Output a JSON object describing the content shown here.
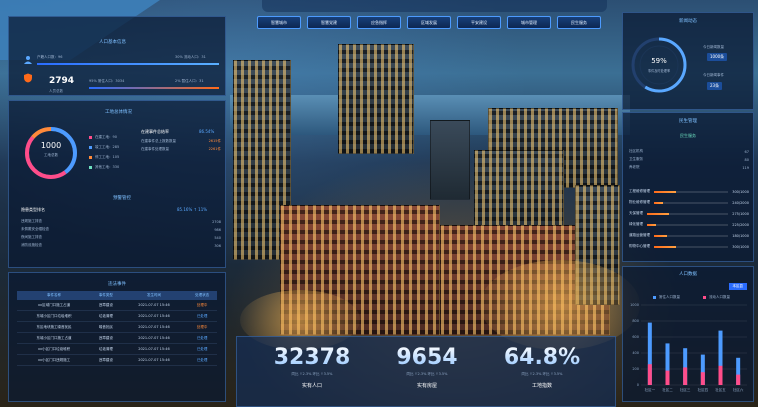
{
  "nav": {
    "items": [
      "智慧城市",
      "智慧党建",
      "应急指挥",
      "区域发展",
      "平安建设",
      "城市管理",
      "民生服务"
    ]
  },
  "left_top": {
    "title": "人口基本信息",
    "row1": {
      "label": "户籍人口数：96",
      "ratio": "30% 流动人口：31"
    },
    "row2": {
      "big": "2794",
      "big_sub": "人员总数",
      "label_left": "95% 常住人口：3034",
      "label_right": "2% 暂住人口：31"
    }
  },
  "left_mid": {
    "title": "工地总体情况",
    "ring_value": "1000",
    "ring_label": "工地总数",
    "legend": [
      "在建工地：90",
      "竣工工地：285",
      "停工工地：105",
      "其他工地：330"
    ],
    "right_title": "在建事件总结率",
    "right_rate": "86.54%",
    "right_rows": [
      {
        "label": "在建事件总上报数数量",
        "value": "2615件"
      },
      {
        "label": "在建事件处理数量",
        "value": "2261件"
      }
    ],
    "mid_title": "预警管控",
    "list_title": "隐患类型排名",
    "list_rate": "85.16% ↑ 11%",
    "list": [
      {
        "label": "违规施工排查",
        "value": "2708"
      },
      {
        "label": "未佩戴安全帽检查",
        "value": "986"
      },
      {
        "label": "夜间施工排查",
        "value": "540"
      },
      {
        "label": "消防设施检查",
        "value": "306"
      }
    ]
  },
  "left_bot": {
    "title": "违法事件",
    "headers": [
      "事件名称",
      "事件类型",
      "发生时间",
      "处理状态"
    ],
    "rows": [
      [
        "xx区域门口施工占道",
        "违章建设",
        "2021-07-07 15:46",
        "处理中"
      ],
      [
        "东城小区门口垃圾堆积",
        "垃圾清理",
        "2021-07-07 15:46",
        "已处理"
      ],
      [
        "东区地块施工噪音扰民",
        "噪音扰民",
        "2021-07-07 15:46",
        "处理中"
      ],
      [
        "东城小区门口施工占道",
        "违章建设",
        "2021-07-07 15:46",
        "已处理"
      ],
      [
        "xx小区门口垃圾堆积",
        "垃圾清理",
        "2021-07-07 15:46",
        "已处理"
      ],
      [
        "xx小区门口违规施工",
        "违章建设",
        "2021-07-07 15:46",
        "已处理"
      ]
    ]
  },
  "right_top": {
    "title": "新闻动态",
    "ring_value": "59%",
    "ring_label": "事件及时处理率",
    "stat1_label": "今日新闻数量",
    "stat1_value": "1000条",
    "stat2_label": "今日新闻事件",
    "stat2_value": "23条"
  },
  "right_mid": {
    "title": "民生管理",
    "subtitle": "民生服务",
    "rows": [
      {
        "label": "社区机构",
        "value": "67"
      },
      {
        "label": "卫生服务",
        "value": "80"
      },
      {
        "label": "养老院",
        "value": "119"
      }
    ],
    "bars": [
      {
        "label": "工程维修管理",
        "value": "300/1000",
        "pct": 0.3
      },
      {
        "label": "物业维修管理",
        "value": "240/2000",
        "pct": 0.12
      },
      {
        "label": "天保管理",
        "value": "275/1000",
        "pct": 0.275
      },
      {
        "label": "绿化管理",
        "value": "225/2000",
        "pct": 0.11
      },
      {
        "label": "道路运营管理",
        "value": "180/1000",
        "pct": 0.18
      },
      {
        "label": "购物中心管理",
        "value": "300/1000",
        "pct": 0.3
      }
    ]
  },
  "right_bot": {
    "title": "人口数据",
    "badge": "本区县",
    "legend": [
      "常住人口数量",
      "流动人口数量"
    ],
    "y_ticks": [
      "1000",
      "800",
      "600",
      "400",
      "200",
      "0"
    ],
    "categories": [
      "社区一",
      "社区二",
      "社区三",
      "社区四",
      "社区五",
      "社区六"
    ],
    "series_a": [
      780,
      520,
      460,
      380,
      680,
      340
    ],
    "series_b": [
      260,
      180,
      220,
      160,
      240,
      130
    ]
  },
  "center_bot": {
    "kpis": [
      {
        "value": "32378",
        "sub": "同比 ↑2.3% 环比 ↑3.5%",
        "label": "实有人口"
      },
      {
        "value": "9654",
        "sub": "同比 ↑2.3% 环比 ↑3.5%",
        "label": "实有房屋"
      },
      {
        "value": "64.8%",
        "sub": "同比 ↑2.3% 环比 ↑3.5%",
        "label": "工地指数"
      }
    ]
  },
  "colors": {
    "accent_blue": "#4d9bff",
    "accent_orange": "#ff7a20",
    "accent_pink": "#ff4d8a"
  }
}
